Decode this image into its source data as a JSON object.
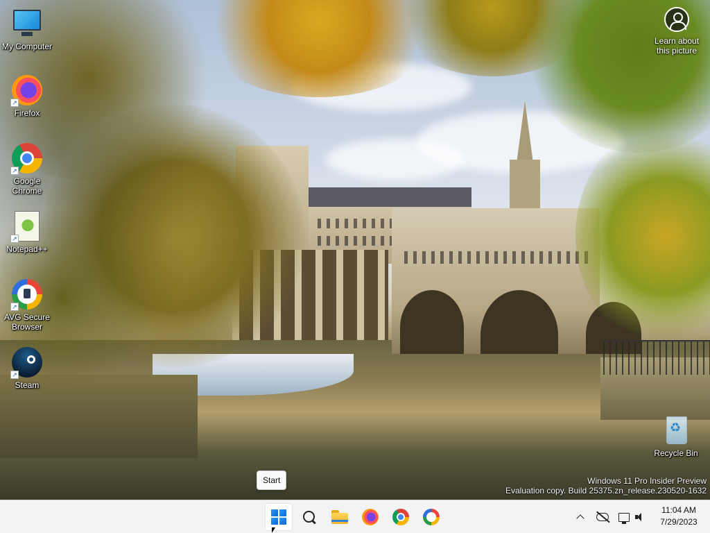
{
  "desktop": {
    "icons": [
      {
        "label": "My Computer",
        "icon": "monitor-icon",
        "shortcut": false
      },
      {
        "label": "Firefox",
        "icon": "firefox-icon",
        "shortcut": true
      },
      {
        "label": "Google Chrome",
        "icon": "chrome-icon",
        "shortcut": true
      },
      {
        "label": "Notepad++",
        "icon": "notepadpp-icon",
        "shortcut": true
      },
      {
        "label": "AVG Secure Browser",
        "icon": "avg-browser-icon",
        "shortcut": true
      },
      {
        "label": "Steam",
        "icon": "steam-icon",
        "shortcut": true
      }
    ],
    "recycle_bin": {
      "label": "Recycle Bin",
      "icon": "recycle-bin-icon"
    },
    "learn": {
      "line1": "Learn about",
      "line2": "this picture",
      "icon": "person-circle-icon"
    },
    "watermark": {
      "line1": "Windows 11 Pro Insider Preview",
      "line2": "Evaluation copy. Build 25375.zn_release.230520-1632"
    },
    "tooltip": "Start"
  },
  "taskbar": {
    "apps": [
      {
        "name": "Start",
        "icon": "windows-icon"
      },
      {
        "name": "Search",
        "icon": "search-icon"
      },
      {
        "name": "File Explorer",
        "icon": "folder-icon"
      },
      {
        "name": "Firefox",
        "icon": "firefox-icon"
      },
      {
        "name": "Google Chrome",
        "icon": "chrome-icon"
      },
      {
        "name": "AVG Secure Browser",
        "icon": "avg-browser-icon"
      }
    ],
    "tray": {
      "icons": [
        "chevron-up-icon",
        "cloud-offline-icon",
        "network-icon",
        "volume-icon"
      ],
      "time": "11:04 AM",
      "date": "7/29/2023"
    }
  },
  "colors": {
    "accent": "#0a66d1",
    "taskbar_bg": "#f2f3f4"
  }
}
